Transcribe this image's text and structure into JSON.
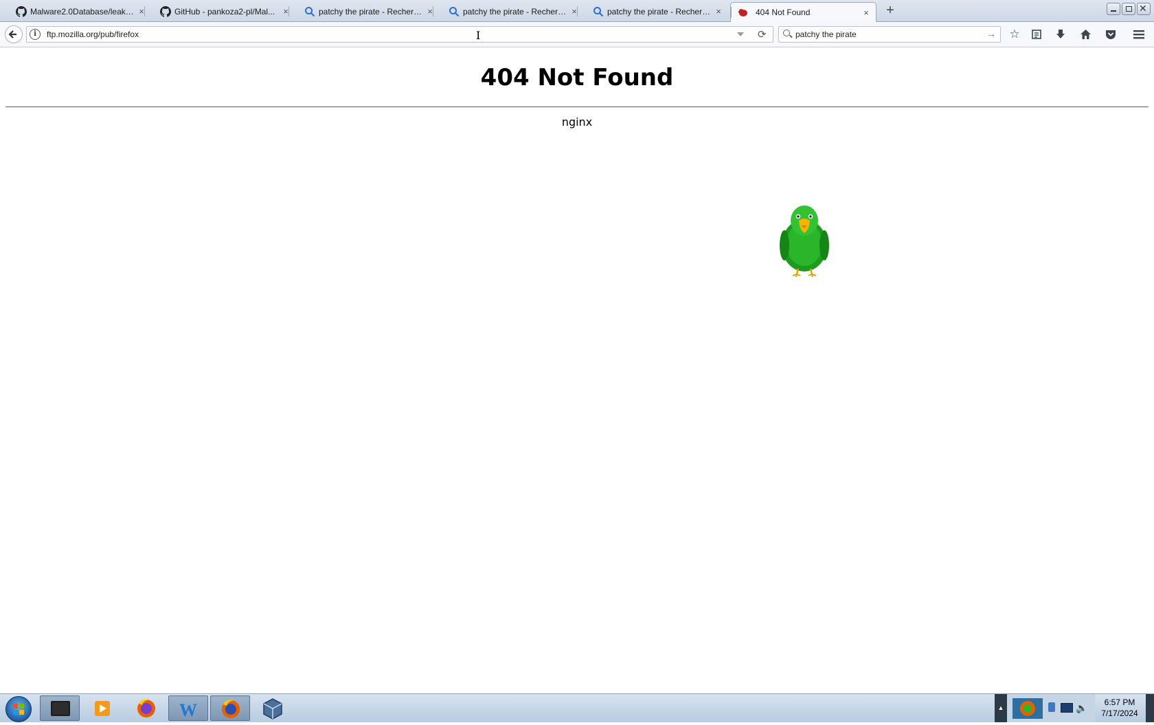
{
  "browser": {
    "tabs": [
      {
        "title": "Malware2.0Database/leake...",
        "icon": "github-icon"
      },
      {
        "title": "GitHub - pankoza2-pl/Mal...",
        "icon": "github-icon"
      },
      {
        "title": "patchy the pirate - Recherc...",
        "icon": "search-icon"
      },
      {
        "title": "patchy the pirate - Recherc...",
        "icon": "search-icon"
      },
      {
        "title": "patchy the pirate - Recherc...",
        "icon": "search-icon"
      },
      {
        "title": "404 Not Found",
        "icon": "parrot-icon",
        "active": true
      }
    ],
    "tab_close": "×",
    "new_tab": "+",
    "url": "ftp.mozilla.org/pub/firefox",
    "search_value": "patchy the pirate",
    "toolbar_icons": [
      "star-icon",
      "reading-list-icon",
      "download-icon",
      "home-icon",
      "pocket-icon",
      "menu-icon"
    ]
  },
  "page": {
    "heading": "404 Not Found",
    "server": "nginx"
  },
  "taskbar": {
    "apps": [
      "terminal-icon",
      "media-player-icon",
      "firefox-icon",
      "wordpad-icon",
      "firefox-icon",
      "virtualbox-icon"
    ],
    "tray_up": "▲",
    "time": "6:57 PM",
    "date": "7/17/2024"
  },
  "colors": {
    "parrot_body": "#2bb52b",
    "parrot_beak": "#f4b400",
    "tab_active_bg": "#f6f8fb",
    "taskbar_bg": "#c3d3e5"
  }
}
